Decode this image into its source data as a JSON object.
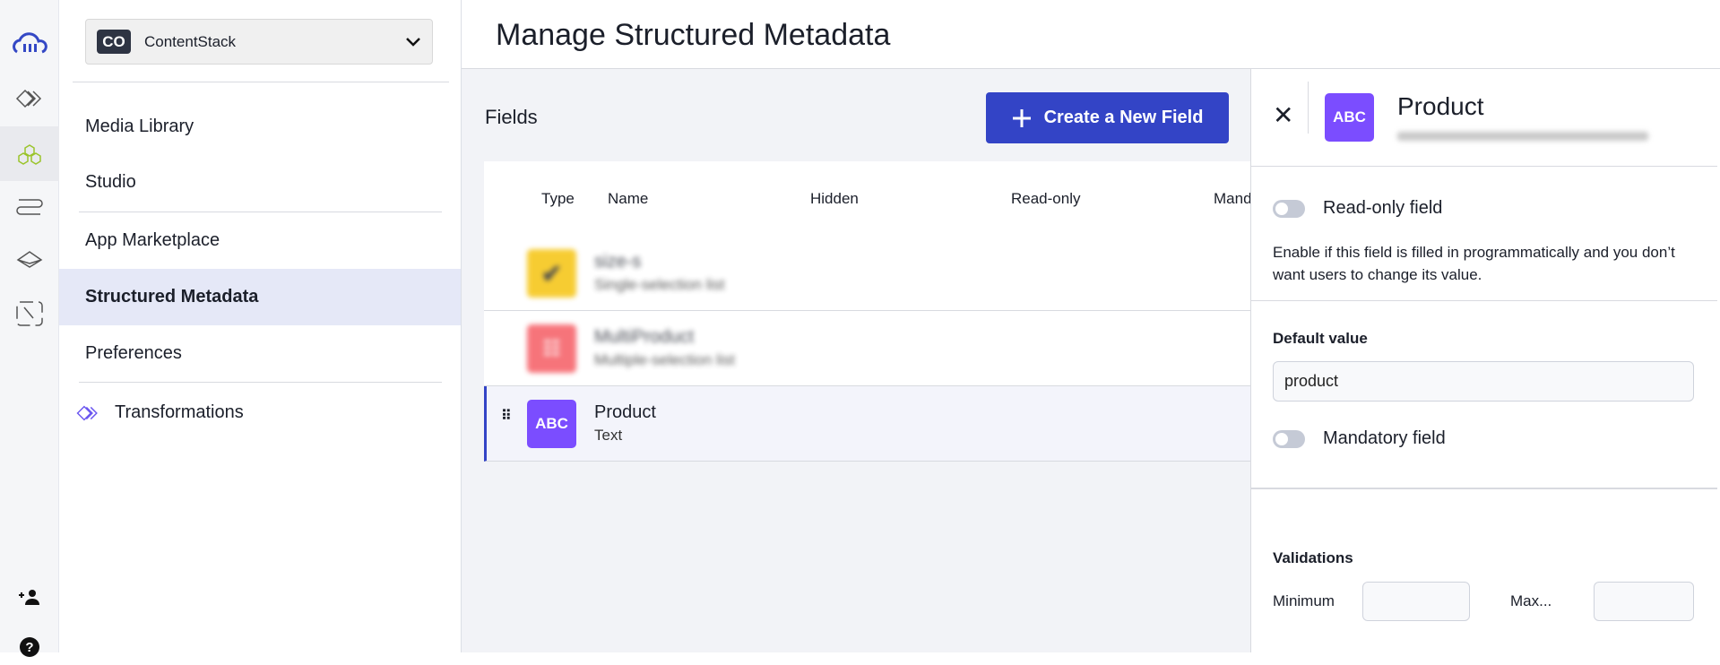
{
  "rail": {
    "icons": [
      "cloudinary-logo-icon",
      "transformations-icon",
      "structured-metadata-icon",
      "workflow-icon",
      "integrations-icon",
      "touch-icon",
      "add-user-icon",
      "help-icon"
    ]
  },
  "nav": {
    "org": {
      "initials": "CO",
      "name": "ContentStack"
    },
    "items": [
      {
        "label": "Media Library"
      },
      {
        "label": "Studio"
      },
      {
        "label": "App Marketplace"
      },
      {
        "label": "Structured Metadata",
        "active": true
      },
      {
        "label": "Preferences"
      },
      {
        "label": "Transformations"
      }
    ]
  },
  "header": {
    "title": "Manage Structured Metadata"
  },
  "main": {
    "fields_title": "Fields",
    "create_button": "Create a New Field",
    "columns": [
      "Type",
      "Name",
      "Hidden",
      "Read-only",
      "Manda"
    ],
    "rows": [
      {
        "name": "size-s",
        "type": "Single-selection list",
        "color": "#f5c000",
        "icon": "checkmark-icon",
        "blurred": true
      },
      {
        "name": "MultiProduct",
        "type": "Multiple-selection list",
        "color": "#f5525a",
        "icon": "multi-list-icon",
        "blurred": true
      },
      {
        "name": "Product",
        "type": "Text",
        "color": "#7b4dff",
        "icon_text": "ABC",
        "selected": true
      }
    ]
  },
  "panel": {
    "icon_text": "ABC",
    "title": "Product",
    "readonly_label": "Read-only field",
    "readonly_on": false,
    "readonly_desc": "Enable if this field is filled in programmatically and you don’t want users to change its value.",
    "default_label": "Default value",
    "default_value": "product",
    "mandatory_label": "Mandatory field",
    "mandatory_on": false,
    "validations_label": "Validations",
    "min_label": "Minimum",
    "max_label": "Max..."
  },
  "colors": {
    "accent": "#3344c6",
    "active_nav": "#e5e8f7",
    "text_type": "#7b4dff"
  }
}
